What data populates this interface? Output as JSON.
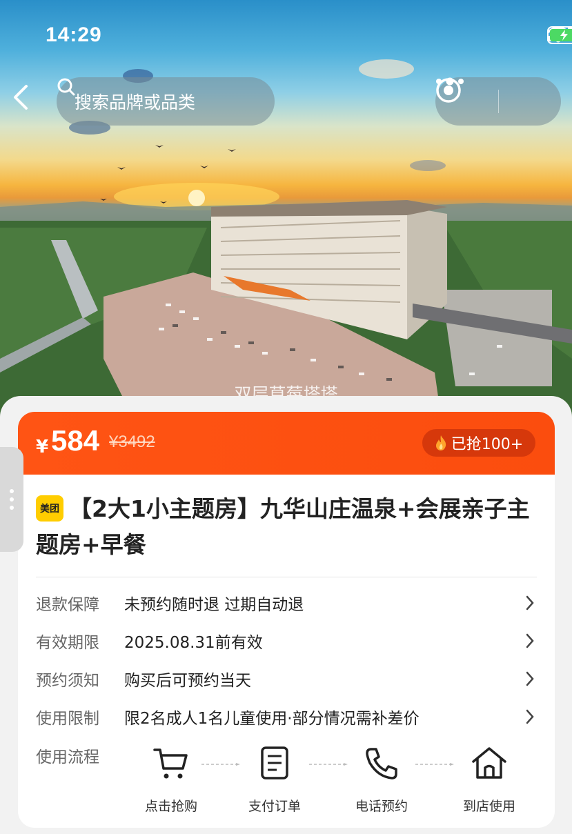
{
  "status_bar": {
    "time": "14:29"
  },
  "header": {
    "search_placeholder": "搜索品牌或品类"
  },
  "hero": {
    "watermark": "双层草莓塔塔"
  },
  "price": {
    "currency": "¥",
    "current": "584",
    "original": "¥3492",
    "sold": "已抢100+"
  },
  "product": {
    "brand_logo_text": "美团",
    "title": "【2大1小主题房】九华山庄温泉+会展亲子主题房+早餐"
  },
  "details": [
    {
      "label": "退款保障",
      "value": "未预约随时退 过期自动退"
    },
    {
      "label": "有效期限",
      "value": "2025.08.31前有效"
    },
    {
      "label": "预约须知",
      "value": "购买后可预约当天"
    },
    {
      "label": "使用限制",
      "value": "限2名成人1名儿童使用·部分情况需补差价"
    }
  ],
  "flow": {
    "label": "使用流程",
    "steps": [
      {
        "label": "点击抢购",
        "icon": "cart-icon"
      },
      {
        "label": "支付订单",
        "icon": "document-icon"
      },
      {
        "label": "电话预约",
        "icon": "phone-icon"
      },
      {
        "label": "到店使用",
        "icon": "home-icon"
      }
    ]
  },
  "colors": {
    "accent": "#ff5414",
    "badge": "#d6380b",
    "brand_yellow": "#ffcd00"
  }
}
